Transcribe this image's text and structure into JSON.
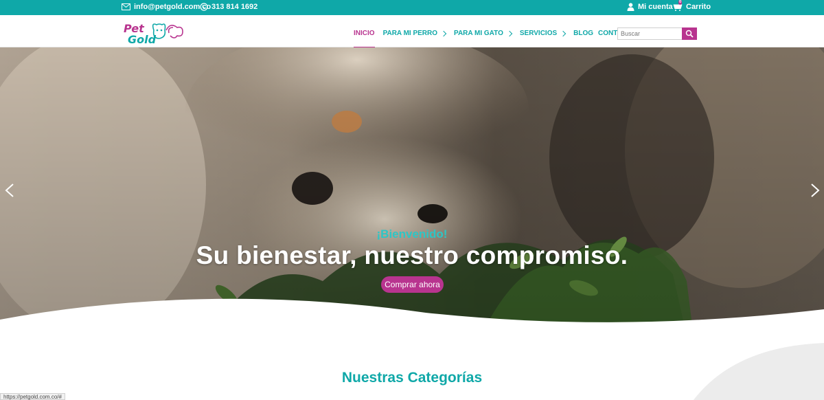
{
  "topbar": {
    "email": "info@petgold.com.co",
    "phone": "313 814 1692",
    "account": "Mi cuenta",
    "cart": "Carrito",
    "cart_count": "0"
  },
  "header": {
    "logo_line1": "Pet",
    "logo_line2": "Gold",
    "nav": [
      {
        "label": "INICIO"
      },
      {
        "label": "PARA MI PERRO"
      },
      {
        "label": "PARA MI GATO"
      },
      {
        "label": "SERVICIOS"
      },
      {
        "label": "BLOG"
      },
      {
        "label": "CONTACTO"
      }
    ],
    "search_placeholder": "Buscar"
  },
  "hero": {
    "welcome": "¡Bienvenido!",
    "headline": "Su bienestar, nuestro compromiso.",
    "cta": "Comprar ahora"
  },
  "section": {
    "title": "Nuestras Categorías"
  },
  "status_bar": {
    "url": "https://petgold.com.co/#"
  },
  "colors": {
    "teal": "#0fa8a8",
    "magenta": "#b8348f",
    "welcome": "#2cc6c6"
  }
}
